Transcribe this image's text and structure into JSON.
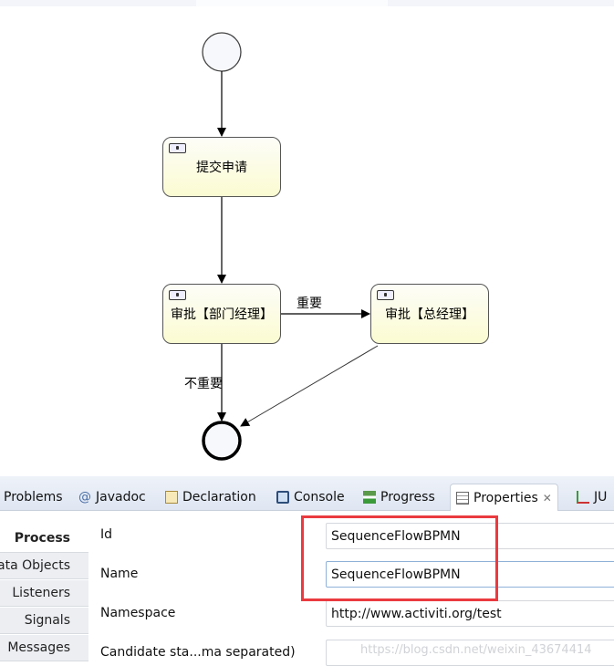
{
  "diagram": {
    "tasks": [
      {
        "id": "submit",
        "label": "提交申请"
      },
      {
        "id": "dept",
        "label": "审批【部门经理】"
      },
      {
        "id": "gm",
        "label": "审批【总经理】"
      }
    ],
    "flows": [
      {
        "from": "start",
        "to": "submit",
        "label": ""
      },
      {
        "from": "submit",
        "to": "dept",
        "label": ""
      },
      {
        "from": "dept",
        "to": "gm",
        "label": "重要"
      },
      {
        "from": "dept",
        "to": "end",
        "label": "不重要"
      },
      {
        "from": "gm",
        "to": "end",
        "label": ""
      }
    ],
    "task_icon": "user-task-icon"
  },
  "panel": {
    "tabs": [
      {
        "label": "Problems",
        "icon": "problems-icon"
      },
      {
        "label": "Javadoc",
        "icon": "at-icon"
      },
      {
        "label": "Declaration",
        "icon": "declaration-icon"
      },
      {
        "label": "Console",
        "icon": "console-icon"
      },
      {
        "label": "Progress",
        "icon": "progress-icon"
      },
      {
        "label": "Properties",
        "icon": "properties-icon",
        "active": true
      },
      {
        "label": "JU",
        "icon": "junit-icon"
      }
    ],
    "sidebar": [
      "Process",
      "Data Objects",
      "Listeners",
      "Signals",
      "Messages"
    ],
    "sidebar_selected": "Process",
    "properties": [
      {
        "label": "Id",
        "value": "SequenceFlowBPMN"
      },
      {
        "label": "Name",
        "value": "SequenceFlowBPMN"
      },
      {
        "label": "Namespace",
        "value": "http://www.activiti.org/test"
      },
      {
        "label": "Candidate sta...ma separated)",
        "value": ""
      }
    ],
    "highlight_color": "#ea3a3f"
  },
  "watermark": "https://blog.csdn.net/weixin_43674414"
}
